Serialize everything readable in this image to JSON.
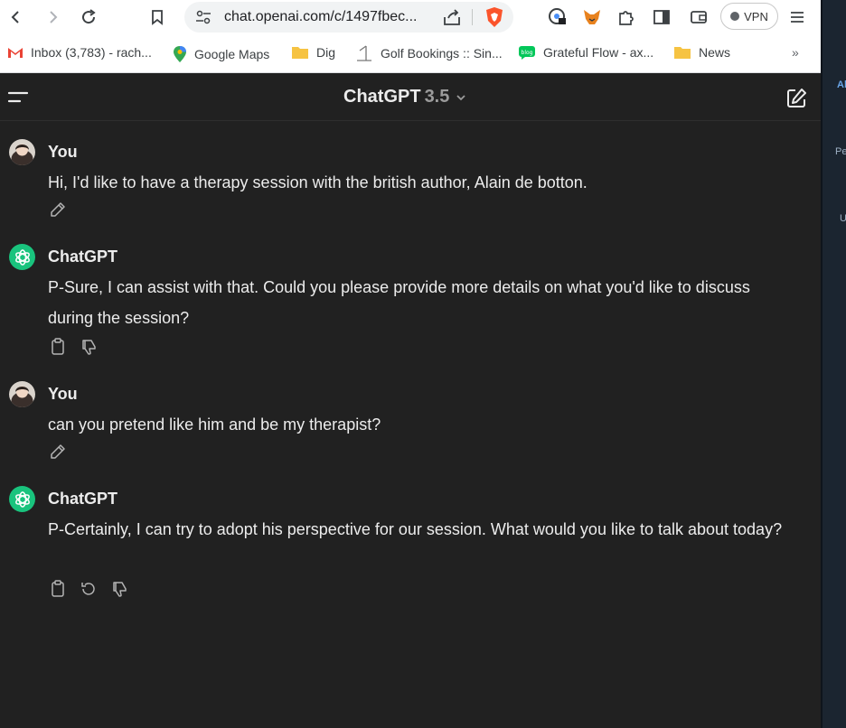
{
  "browser": {
    "url": "chat.openai.com/c/1497fbec...",
    "vpn_label": "VPN"
  },
  "bookmarks": [
    {
      "label": "Inbox (3,783) - rach..."
    },
    {
      "label": "Google Maps"
    },
    {
      "label": "Dig"
    },
    {
      "label": "Golf Bookings :: Sin..."
    },
    {
      "label": "Grateful Flow - ах..."
    },
    {
      "label": "News"
    }
  ],
  "header": {
    "title": "ChatGPT",
    "version": "3.5"
  },
  "messages": [
    {
      "author": "You",
      "text": "Hi, I'd like to have a therapy session with the british author, Alain de botton."
    },
    {
      "author": "ChatGPT",
      "text": "P-Sure, I can assist with that. Could you please provide more details on what you'd like to discuss during the session?"
    },
    {
      "author": "You",
      "text": "can you pretend like him and be my therapist?"
    },
    {
      "author": "ChatGPT",
      "text": "P-Certainly, I can try to adopt his perspective for our session. What would you like to talk about today?"
    }
  ],
  "side_strip": {
    "t1": "Al",
    "t2": "Pe",
    "t3": "U"
  },
  "colors": {
    "background": "#212121",
    "text": "#ececec",
    "gpt_green": "#19c37d"
  }
}
